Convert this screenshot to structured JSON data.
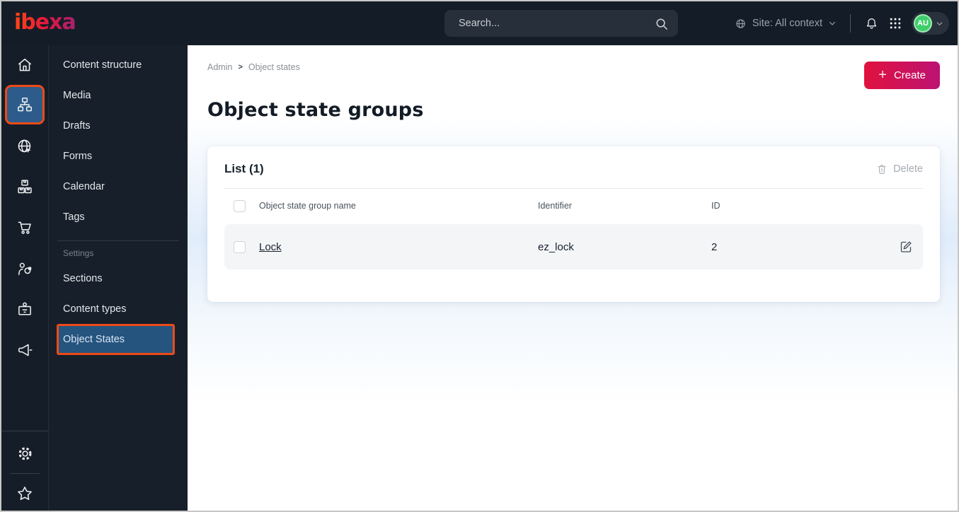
{
  "topbar": {
    "logo_text": "ibexa",
    "search_placeholder": "Search...",
    "site_context_label": "Site: All context",
    "avatar_initials": "AU"
  },
  "sidebar_icons": [
    {
      "name": "home",
      "active": false
    },
    {
      "name": "content-structure",
      "active": true
    },
    {
      "name": "site",
      "active": false
    },
    {
      "name": "product-catalog",
      "active": false
    },
    {
      "name": "commerce",
      "active": false
    },
    {
      "name": "personalization",
      "active": false
    },
    {
      "name": "customer-portal",
      "active": false
    },
    {
      "name": "marketing",
      "active": false
    },
    {
      "name": "settings",
      "active": false
    },
    {
      "name": "bookmarks",
      "active": false
    }
  ],
  "menu": {
    "items": [
      "Content structure",
      "Media",
      "Drafts",
      "Forms",
      "Calendar",
      "Tags"
    ],
    "section_label": "Settings",
    "settings_items": [
      "Sections",
      "Content types",
      "Object States"
    ],
    "active_item": "Object States"
  },
  "main": {
    "breadcrumb": {
      "root": "Admin",
      "separator": ">",
      "current": "Object states"
    },
    "page_title": "Object state groups",
    "create_button_label": "Create",
    "list_card": {
      "title": "List (1)",
      "delete_label": "Delete",
      "columns": [
        "Object state group name",
        "Identifier",
        "ID"
      ],
      "rows": [
        {
          "name": "Lock",
          "identifier": "ez_lock",
          "id": "2"
        }
      ]
    }
  },
  "colors": {
    "topbar_bg": "#141d27",
    "sidebar_bg": "#151e28",
    "active_highlight_bg": "#2d5c8a",
    "annotation_border": "#ed4a17",
    "create_gradient_start": "#e0123e",
    "create_gradient_end": "#bc1273",
    "avatar_green": "#3ece6a",
    "row_bg": "#f4f5f7"
  }
}
